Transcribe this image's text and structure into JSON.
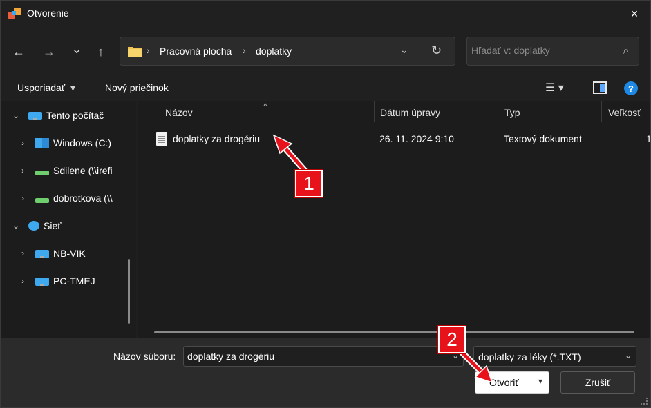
{
  "window": {
    "title": "Otvorenie",
    "close_icon": "×"
  },
  "nav": {
    "back_icon": "←",
    "forward_icon": "→",
    "recent_icon": "⌄",
    "up_icon": "↑",
    "breadcrumb": [
      "Pracovná plocha",
      "doplatky"
    ],
    "breadcrumb_sep": "›",
    "address_dropdown_icon": "⌄",
    "refresh_icon": "↻",
    "search_placeholder": "Hľadať v: doplatky",
    "search_icon": "⌕"
  },
  "commands": {
    "organize": "Usporiadať",
    "organize_caret": "▾",
    "new_folder": "Nový priečinok",
    "view_icon": "☰ ▾",
    "help_icon": "?"
  },
  "sidebar": {
    "items": [
      {
        "label": "Tento počítač",
        "chevron": "⌄",
        "icon": "monitor-icon"
      },
      {
        "label": "Windows (C:)",
        "chevron": "›",
        "icon": "windows-drive-icon"
      },
      {
        "label": "Sdilene (\\\\irefi",
        "chevron": "›",
        "icon": "network-drive-icon"
      },
      {
        "label": "dobrotkova (\\\\",
        "chevron": "›",
        "icon": "network-drive-icon"
      },
      {
        "label": "Sieť",
        "chevron": "⌄",
        "icon": "network-icon"
      },
      {
        "label": "NB-VIK",
        "chevron": "›",
        "icon": "computer-icon"
      },
      {
        "label": "PC-TMEJ",
        "chevron": "›",
        "icon": "computer-icon"
      }
    ]
  },
  "filelist": {
    "columns": [
      "Názov",
      "Dátum úpravy",
      "Typ",
      "Veľkosť"
    ],
    "sort_icon": "^",
    "rows": [
      {
        "name": "doplatky za drogériu",
        "date": "26. 11. 2024 9:10",
        "type": "Textový dokument",
        "size": "1"
      }
    ]
  },
  "bottom": {
    "filename_label": "Názov súboru:",
    "filename_value": "doplatky za drogériu",
    "filename_dd_icon": "⌄",
    "filetype": "doplatky za léky (*.TXT)",
    "filetype_dd_icon": "⌄",
    "open_label": "Otvoriť",
    "open_dd_icon": "▾",
    "cancel_label": "Zrušiť"
  },
  "annotations": {
    "badge1": "1",
    "badge2": "2",
    "color": "#e8121b"
  },
  "colors": {
    "accent": "#1e88e5",
    "background": "#1f1f1f",
    "annotation": "#e8121b"
  }
}
